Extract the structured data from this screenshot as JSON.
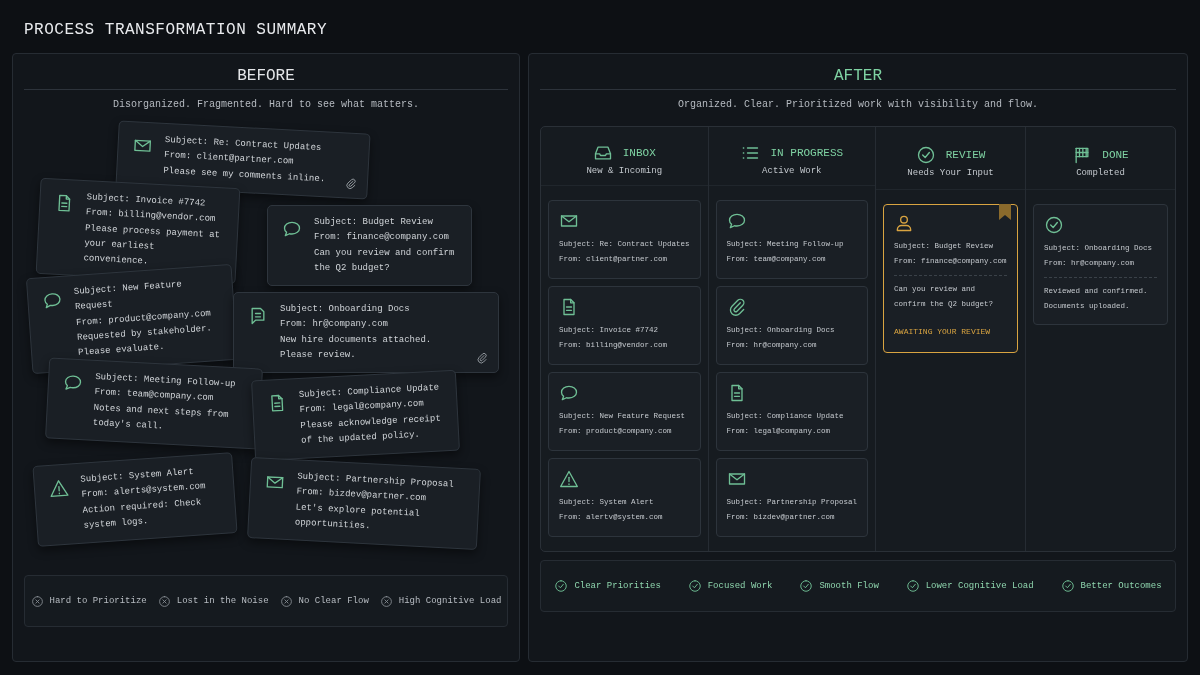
{
  "title": "PROCESS TRANSFORMATION SUMMARY",
  "before": {
    "title": "BEFORE",
    "subtitle": "Disorganized. Fragmented. Hard to see what matters.",
    "emails": [
      {
        "kind": "mail",
        "subject": "Subject: Re: Contract Updates",
        "from": "From: client@partner.com",
        "body": "Please see my comments inline.",
        "attachment": true
      },
      {
        "kind": "doc",
        "subject": "Subject: Invoice #7742",
        "from": "From: billing@vendor.com",
        "body": "Please process payment at your earliest convenience.",
        "attachment": false
      },
      {
        "kind": "chat",
        "subject": "Subject: Budget Review",
        "from": "From: finance@company.com",
        "body": "Can you review and confirm the Q2 budget?",
        "attachment": false
      },
      {
        "kind": "chat",
        "subject": "Subject: New Feature Request",
        "from": "From: product@company.com",
        "body": "Requested by stakeholder. Please evaluate.",
        "attachment": false
      },
      {
        "kind": "note",
        "subject": "Subject: Onboarding Docs",
        "from": "From: hr@company.com",
        "body": "New hire documents attached. Please review.",
        "attachment": true
      },
      {
        "kind": "chat",
        "subject": "Subject: Meeting Follow-up",
        "from": "From: team@company.com",
        "body": "Notes and next steps from today's call.",
        "attachment": false
      },
      {
        "kind": "doc",
        "subject": "Subject: Compliance Update",
        "from": "From: legal@company.com",
        "body": "Please acknowledge receipt of the updated policy.",
        "attachment": false
      },
      {
        "kind": "alert",
        "subject": "Subject: System Alert",
        "from": "From: alerts@system.com",
        "body": "Action required: Check system logs.",
        "attachment": false
      },
      {
        "kind": "mail",
        "subject": "Subject: Partnership Proposal",
        "from": "From: bizdev@partner.com",
        "body": "Let's explore potential opportunities.",
        "attachment": false
      }
    ],
    "pains": [
      "Hard to Prioritize",
      "Lost in the Noise",
      "No Clear Flow",
      "High Cognitive Load"
    ]
  },
  "after": {
    "title": "AFTER",
    "subtitle": "Organized. Clear. Prioritized work with visibility and flow.",
    "columns": [
      {
        "kind": "inbox",
        "title": "INBOX",
        "subtitle": "New & Incoming",
        "cards": [
          {
            "kind": "mail",
            "subject": "Subject: Re: Contract Updates",
            "from": "From: client@partner.com",
            "flagged": false
          },
          {
            "kind": "doc",
            "subject": "Subject: Invoice #7742",
            "from": "From: billing@vendor.com",
            "flagged": false
          },
          {
            "kind": "chat",
            "subject": "Subject: New Feature Request",
            "from": "From: product@company.com",
            "flagged": false
          },
          {
            "kind": "alert",
            "subject": "Subject: System Alert",
            "from": "From: alertv@system.com",
            "flagged": false
          }
        ]
      },
      {
        "kind": "list",
        "title": "IN PROGRESS",
        "subtitle": "Active Work",
        "cards": [
          {
            "kind": "chat",
            "subject": "Subject: Meeting Follow-up",
            "from": "From: team@company.com",
            "flagged": false
          },
          {
            "kind": "clip",
            "subject": "Subject: Onboarding Docs",
            "from": "From: hr@company.com",
            "flagged": false
          },
          {
            "kind": "doc",
            "subject": "Subject: Compliance Update",
            "from": "From: legal@company.com",
            "flagged": false
          },
          {
            "kind": "mail",
            "subject": "Subject: Partnership Proposal",
            "from": "From: bizdev@partner.com",
            "flagged": false
          }
        ]
      },
      {
        "kind": "check",
        "title": "REVIEW",
        "subtitle": "Needs Your Input",
        "cards": [
          {
            "kind": "person",
            "subject": "Subject: Budget Review",
            "from": "From: finance@company.com",
            "body": "Can you review and confirm the Q2 budget?",
            "status": "AWAITING YOUR REVIEW",
            "flagged": true
          }
        ]
      },
      {
        "kind": "flag",
        "title": "DONE",
        "subtitle": "Completed",
        "cards": [
          {
            "kind": "check",
            "subject": "Subject: Onboarding Docs",
            "from": "From: hr@company.com",
            "body": "Reviewed and confirmed. Documents uploaded.",
            "flagged": false
          }
        ]
      }
    ],
    "benefits": [
      "Clear Priorities",
      "Focused Work",
      "Smooth Flow",
      "Lower Cognitive Load",
      "Better Outcomes"
    ]
  }
}
